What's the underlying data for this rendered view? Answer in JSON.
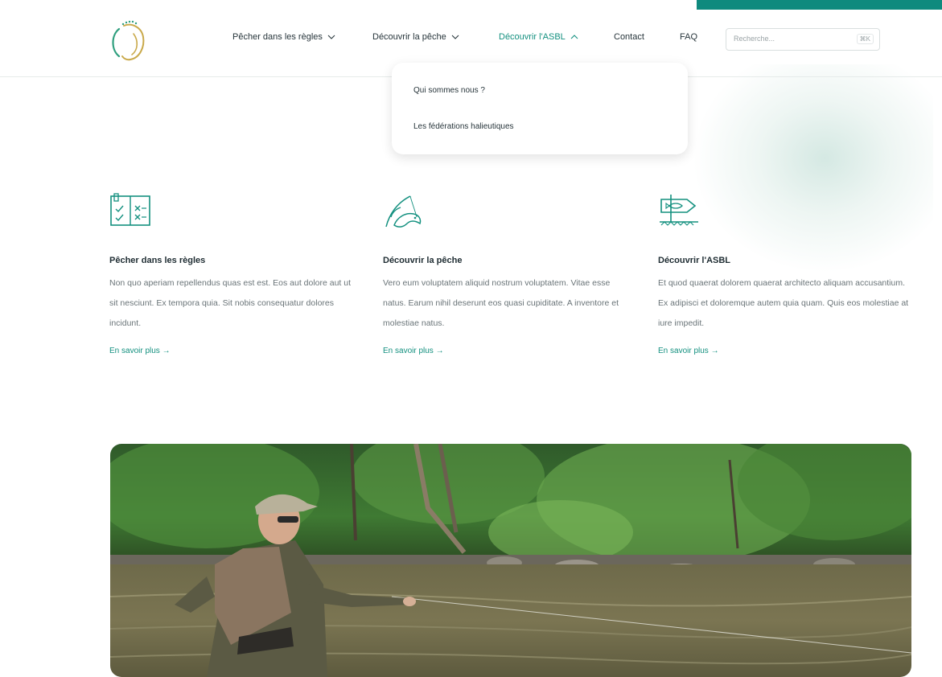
{
  "header": {
    "logo_icon": "circular-fish-logo",
    "nav": [
      {
        "label": "Pêcher dans les règles",
        "icon": "chevron-down-icon"
      },
      {
        "label": "Découvrir la pêche",
        "icon": "chevron-down-icon"
      },
      {
        "label": "Découvrir l'ASBL",
        "icon": "chevron-up-icon"
      },
      {
        "label": "Contact"
      },
      {
        "label": "FAQ"
      }
    ],
    "search": {
      "placeholder": "Recherche...",
      "shortcut": "⌘K"
    }
  },
  "dropdown": {
    "items": [
      "Qui sommes nous ?",
      "Les fédérations halieutiques"
    ]
  },
  "features": [
    {
      "icon": "rulebook-icon",
      "title": "Pêcher dans les règles",
      "desc": "Non quo aperiam repellendus quas est est. Eos aut dolore aut ut sit nesciunt. Ex tempora quia. Sit nobis consequatur dolores incidunt.",
      "link": "En savoir plus →"
    },
    {
      "icon": "fishing-rod-fish-icon",
      "title": "Découvrir la pêche",
      "desc": "Vero eum voluptatem aliquid nostrum voluptatem. Vitae esse natus. Earum nihil deserunt eos quasi cupiditate. A inventore et molestiae natus.",
      "link": "En savoir plus →"
    },
    {
      "icon": "signpost-fish-icon",
      "title": "Découvrir l'ASBL",
      "desc": "Et quod quaerat dolorem quaerat architecto aliquam accusantium. Ex adipisci et doloremque autem quia quam. Quis eos molestiae at iure impedit.",
      "link": "En savoir plus →"
    }
  ],
  "hero_image": {
    "subject": "fly-fisherman-in-river-photo"
  },
  "colors": {
    "accent": "#13907f",
    "strip": "#0f8a7e",
    "text": "#1f2d33",
    "muted": "#6a7478"
  }
}
